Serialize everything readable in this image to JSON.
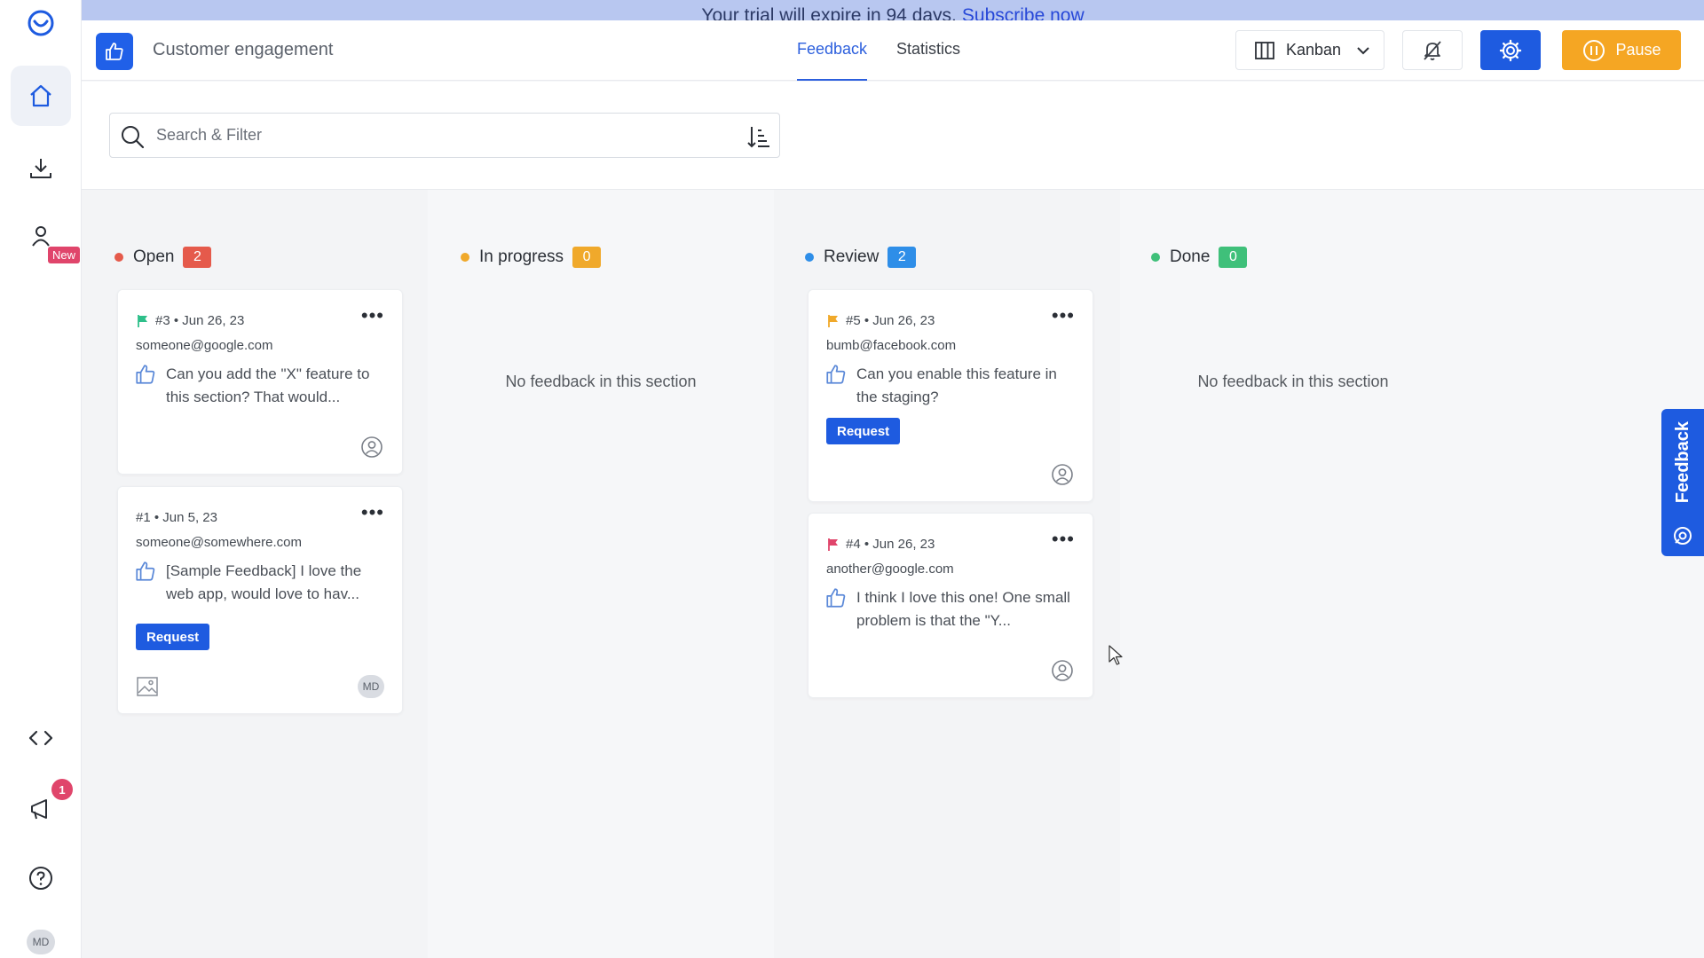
{
  "banner": {
    "text": "Your trial will expire in 94 days.",
    "link": "Subscribe now"
  },
  "sidebar": {
    "new_badge": "New",
    "notification_count": "1",
    "avatar": "MD"
  },
  "header": {
    "project_title": "Customer engagement",
    "tabs": [
      {
        "label": "Feedback",
        "active": true
      },
      {
        "label": "Statistics",
        "active": false
      }
    ],
    "view_label": "Kanban",
    "pause_label": "Pause"
  },
  "search": {
    "placeholder": "Search & Filter"
  },
  "colors": {
    "primary": "#1e5be0",
    "open": "#e55a4b",
    "in_progress": "#f0a92b",
    "review": "#2e8ee8",
    "done": "#3fc07a",
    "pause": "#f5a623"
  },
  "columns": [
    {
      "title": "Open",
      "count": "2",
      "cards": [
        {
          "flag": "green",
          "number": "#3",
          "date": "Jun 26, 23",
          "email": "someone@google.com",
          "text": "Can you add the \"X\" feature to this section? That would...",
          "tag": ""
        },
        {
          "flag": "",
          "number": "#1",
          "date": "Jun 5, 23",
          "email": "someone@somewhere.com",
          "text": "[Sample Feedback] I love the web app, would love to hav...",
          "tag": "Request",
          "avatar": "MD"
        }
      ]
    },
    {
      "title": "In progress",
      "count": "0",
      "empty_text": "No feedback in this section"
    },
    {
      "title": "Review",
      "count": "2",
      "cards": [
        {
          "flag": "orange",
          "number": "#5",
          "date": "Jun 26, 23",
          "email": "bumb@facebook.com",
          "text": "Can you enable this feature in the staging?",
          "tag": "Request"
        },
        {
          "flag": "pink",
          "number": "#4",
          "date": "Jun 26, 23",
          "email": "another@google.com",
          "text": "I think I love this one! One small problem is that the \"Y...",
          "tag": ""
        }
      ]
    },
    {
      "title": "Done",
      "count": "0",
      "empty_text": "No feedback in this section"
    }
  ],
  "feedback_tab": {
    "label": "Feedback"
  }
}
